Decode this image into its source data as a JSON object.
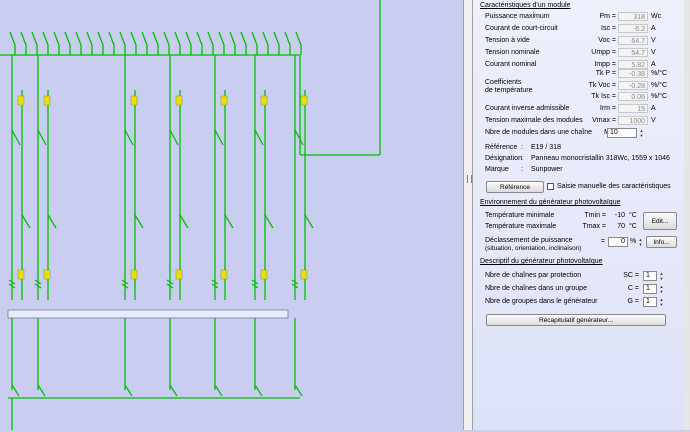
{
  "module": {
    "section_title": "Caractéristiques d'un module",
    "rows": [
      {
        "label": "Puissance maximum",
        "symbol": "Pm =",
        "value": "318",
        "unit": "Wc"
      },
      {
        "label": "Courant de court-circuit",
        "symbol": "Isc =",
        "value": "6.2",
        "unit": "A"
      },
      {
        "label": "Tension à vide",
        "symbol": "Voc =",
        "value": "64.7",
        "unit": "V"
      },
      {
        "label": "Tension nominale",
        "symbol": "Umpp =",
        "value": "54.7",
        "unit": "V"
      },
      {
        "label": "Courant nominal",
        "symbol": "Impp =",
        "value": "5.82",
        "unit": "A"
      }
    ],
    "coef_label_1": "Coefficients",
    "coef_label_2": "de température",
    "coefs": [
      {
        "symbol": "Tk P =",
        "value": "-0.38",
        "unit": "%/°C"
      },
      {
        "symbol": "Tk Voc =",
        "value": "-0.28",
        "unit": "%/°C"
      },
      {
        "symbol": "Tk Isc =",
        "value": "0.06",
        "unit": "%/°C"
      }
    ],
    "irm": {
      "label": "Courant inverse admissible",
      "symbol": "Irm =",
      "value": "15",
      "unit": "A"
    },
    "vmax": {
      "label": "Tension maximale des modules",
      "symbol": "Vmax =",
      "value": "1000",
      "unit": "V"
    },
    "count": {
      "label": "Nbre de modules dans une chaîne",
      "symbol": "M =",
      "value": "10"
    },
    "reference": {
      "label": "Référence",
      "sep": ":",
      "value": "E19 / 318"
    },
    "designation": {
      "label": "Désignation",
      "sep": ":",
      "value": "Panneau monocristallin 318Wc, 1559 x 1046"
    },
    "brand": {
      "label": "Marque",
      "sep": ":",
      "value": "Sunpower"
    },
    "reference_button": "Référence",
    "manual_checkbox": "Saisie manuelle des caractéristiques"
  },
  "environment": {
    "section_title": "Environnement du générateur photovoltaïque",
    "tmin": {
      "label": "Température minimale",
      "symbol": "Tmin =",
      "value": "-10",
      "unit": "°C"
    },
    "tmax": {
      "label": "Température maximale",
      "symbol": "Tmax =",
      "value": "70",
      "unit": "°C"
    },
    "edit_button": "Edit...",
    "derating": {
      "label": "Déclassement de puissance",
      "sublabel": "(situation, orientation, inclinaison)",
      "symbol": "=",
      "value": "0",
      "unit": "%"
    },
    "info_button": "Info..."
  },
  "generator": {
    "section_title": "Descriptif du générateur photovoltaïque",
    "rows": [
      {
        "label": "Nbre de chaînes par protection",
        "symbol": "SC =",
        "value": "1"
      },
      {
        "label": "Nbre de chaînes dans un groupe",
        "symbol": "C =",
        "value": "1"
      },
      {
        "label": "Nbre de groupes dans le générateur",
        "symbol": "G =",
        "value": "1"
      }
    ],
    "summary_button": "Récapitulatif générateur..."
  },
  "colors": {
    "wire": "#00c000",
    "background": "#c9cdf0",
    "fuse": "#e8e000"
  }
}
